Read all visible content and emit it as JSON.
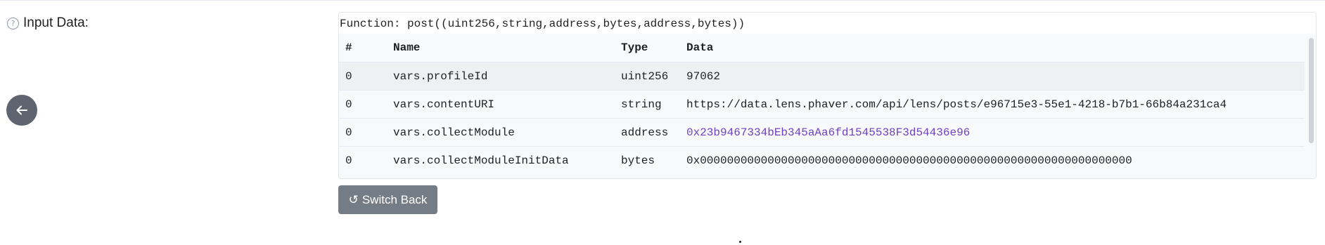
{
  "label": {
    "text": "Input Data:",
    "help_icon": "question-circle-icon"
  },
  "back_button": {
    "icon": "arrow-left-icon"
  },
  "decode": {
    "function_line": "Function: post((uint256,string,address,bytes,address,bytes))",
    "headers": {
      "index": "#",
      "name": "Name",
      "type": "Type",
      "data": "Data"
    },
    "rows": [
      {
        "index": "0",
        "name": "vars.profileId",
        "type": "uint256",
        "data": "97062"
      },
      {
        "index": "0",
        "name": "vars.contentURI",
        "type": "string",
        "data": "https://data.lens.phaver.com/api/lens/posts/e96715e3-55e1-4218-b7b1-66b84a231ca4"
      },
      {
        "index": "0",
        "name": "vars.collectModule",
        "type": "address",
        "data": "0x23b9467334bEb345aAa6fd1545538F3d54436e96"
      },
      {
        "index": "0",
        "name": "vars.collectModuleInitData",
        "type": "bytes",
        "data": "0x0000000000000000000000000000000000000000000000000000000000000000"
      }
    ]
  },
  "switch_button": {
    "label": "Switch Back",
    "icon": "undo-icon"
  },
  "colors": {
    "link": "#6f42c1",
    "button": "#747c85",
    "back_button": "#5e6570"
  }
}
